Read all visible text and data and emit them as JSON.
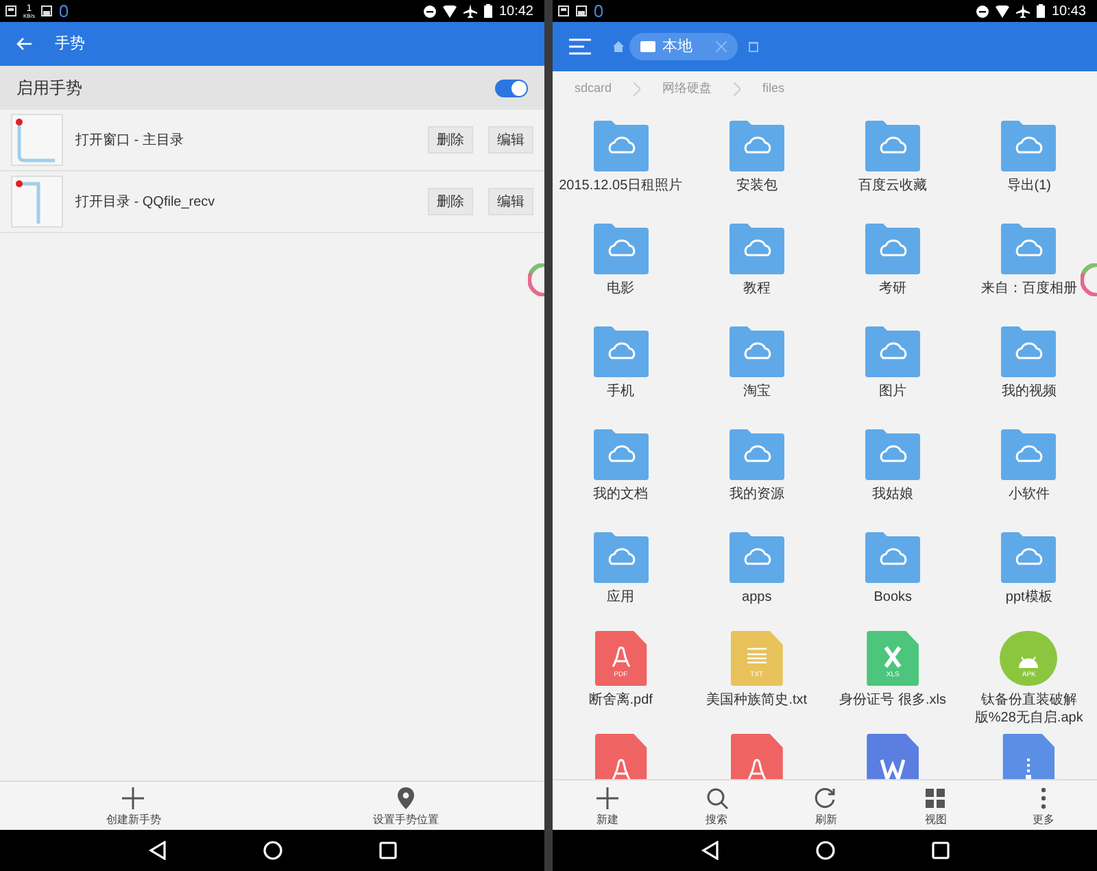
{
  "left_phone": {
    "status_bar": {
      "net_speed": "1",
      "net_unit": "KB/s",
      "time": "10:42"
    },
    "app_bar": {
      "title": "手势"
    },
    "enable_row": {
      "label": "启用手势",
      "on": true
    },
    "gestures": [
      {
        "label": "打开窗口 - 主目录",
        "kind": "ell",
        "buttons": [
          "删除",
          "编辑"
        ]
      },
      {
        "label": "打开目录 - QQfile_recv",
        "kind": "hook",
        "buttons": [
          "删除",
          "编辑"
        ]
      }
    ],
    "bottom_bar": [
      {
        "kind": "add",
        "label": "创建新手势"
      },
      {
        "kind": "pin",
        "label": "设置手势位置"
      }
    ]
  },
  "right_phone": {
    "status_bar": {
      "time": "10:43"
    },
    "tab": {
      "label": "本地"
    },
    "breadcrumb": [
      "sdcard",
      "网络硬盘",
      "files"
    ],
    "files": [
      {
        "kind": "folder",
        "name": "2015.12.05日租照片"
      },
      {
        "kind": "folder",
        "name": "安装包"
      },
      {
        "kind": "folder",
        "name": "百度云收藏"
      },
      {
        "kind": "folder",
        "name": "导出(1)"
      },
      {
        "kind": "folder",
        "name": "电影"
      },
      {
        "kind": "folder",
        "name": "教程"
      },
      {
        "kind": "folder",
        "name": "考研"
      },
      {
        "kind": "folder",
        "name": "来自：百度相册"
      },
      {
        "kind": "folder",
        "name": "手机"
      },
      {
        "kind": "folder",
        "name": "淘宝"
      },
      {
        "kind": "folder",
        "name": "图片"
      },
      {
        "kind": "folder",
        "name": "我的视频"
      },
      {
        "kind": "folder",
        "name": "我的文档"
      },
      {
        "kind": "folder",
        "name": "我的资源"
      },
      {
        "kind": "folder",
        "name": "我姑娘"
      },
      {
        "kind": "folder",
        "name": "小软件"
      },
      {
        "kind": "folder",
        "name": "应用"
      },
      {
        "kind": "folder",
        "name": "apps"
      },
      {
        "kind": "folder",
        "name": "Books"
      },
      {
        "kind": "folder",
        "name": "ppt模板"
      },
      {
        "kind": "pdf",
        "badge": "PDF",
        "name": "断舍离.pdf"
      },
      {
        "kind": "txt",
        "badge": "TXT",
        "name": "美国种族简史.txt"
      },
      {
        "kind": "xls",
        "badge": "XLS",
        "name": "身份证号 很多.xls"
      },
      {
        "kind": "apk",
        "badge": "APK",
        "name": "钛备份直装破解版%28无自启.apk"
      },
      {
        "kind": "pdf"
      },
      {
        "kind": "pdf"
      },
      {
        "kind": "doc"
      },
      {
        "kind": "zip"
      }
    ],
    "toolbar": [
      {
        "kind": "add",
        "label": "新建"
      },
      {
        "kind": "search",
        "label": "搜索"
      },
      {
        "kind": "refresh",
        "label": "刷新"
      },
      {
        "kind": "grid",
        "label": "视图"
      },
      {
        "kind": "more",
        "label": "更多"
      }
    ]
  }
}
